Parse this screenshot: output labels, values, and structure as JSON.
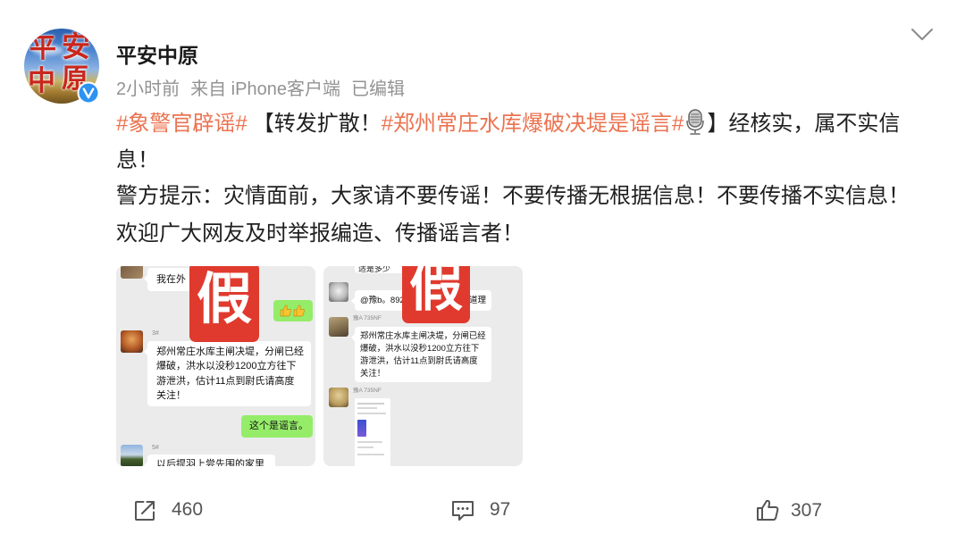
{
  "author": {
    "name": "平安中原",
    "avatar_lettering": [
      "平",
      "安",
      "中",
      "原"
    ],
    "verified_icon": "verified-badge-icon"
  },
  "meta": {
    "time": "2小时前",
    "source": "来自 iPhone客户端",
    "edited": "已编辑"
  },
  "menu_icon": "chevron-down-icon",
  "content": {
    "line1": {
      "topic1": "#象警官辟谣#",
      "text1": "【转发扩散！",
      "topic2": "#郑州常庄水库爆破决堤是谣言#",
      "emoji": "microphone-icon",
      "text2": "】经核实，属不实信"
    },
    "line2": "息！",
    "line3": "警方提示：灾情面前，大家请不要传谣！不要传播无根据信息！不要传播不实信息！",
    "line4": "欢迎广大网友及时举报编造、传播谣言者！"
  },
  "colors": {
    "topic": "#eb7350",
    "text": "#1f1f1f",
    "meta": "#939393",
    "stamp": "#e03a2e",
    "wechat_green": "#95ec69"
  },
  "images": [
    {
      "stamp": "假",
      "top_bubble": "我在外",
      "reaction_icons": [
        "thumbs-up-emoji",
        "thumbs-up-emoji"
      ],
      "sender_3": "3#",
      "rumor_lines": [
        "郑州常庄水库主闸决堤，分闸已经",
        "爆破，洪水以没秒1200立方往下",
        "游泄洪，估计11点到尉氏请高度",
        "关注！"
      ],
      "reply": "这个是谣言。",
      "sender_5": "5#",
      "bottom_bubble": "以后提羽上尝先围的家里"
    },
    {
      "stamp": "假",
      "top_bubble": "适是多少",
      "mention_start": "@豫b。892",
      "mention_end": "道理",
      "sender_a": "豫A 735NF",
      "rumor_lines": [
        "郑州常庄水库主闸决堤，分闸已经",
        "爆破，洪水以没秒1200立方往下",
        "游泄洪，估计11点到尉氏请高度",
        "关注！"
      ],
      "sender_b": "豫A 735NF"
    }
  ],
  "actions": {
    "share": {
      "icon": "share-icon",
      "count": "460"
    },
    "comment": {
      "icon": "comment-icon",
      "count": "97"
    },
    "like": {
      "icon": "like-icon",
      "count": "307"
    }
  }
}
